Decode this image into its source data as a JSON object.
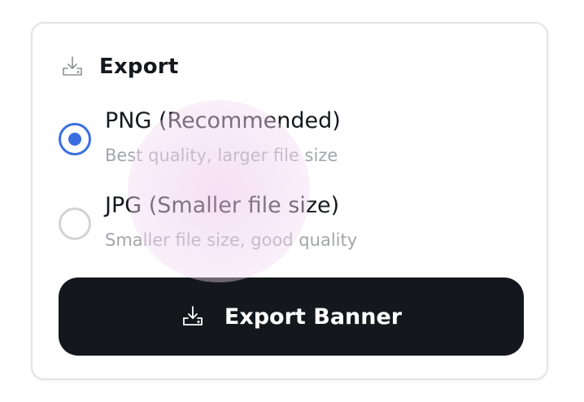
{
  "export_panel": {
    "title": "Export",
    "header_icon": "download-tray-icon",
    "options": [
      {
        "title": "PNG (Recommended)",
        "description": "Best quality, larger file size",
        "selected": true
      },
      {
        "title": "JPG (Smaller file size)",
        "description": "Smaller file size, good quality",
        "selected": false
      }
    ],
    "button": {
      "label": "Export Banner",
      "icon": "download-tray-icon"
    }
  },
  "colors": {
    "accent": "#3a6ee0",
    "button_bg": "#14181d",
    "text_primary": "#15181d",
    "text_secondary": "#a3a5ab",
    "border": "#e3e4e7"
  }
}
